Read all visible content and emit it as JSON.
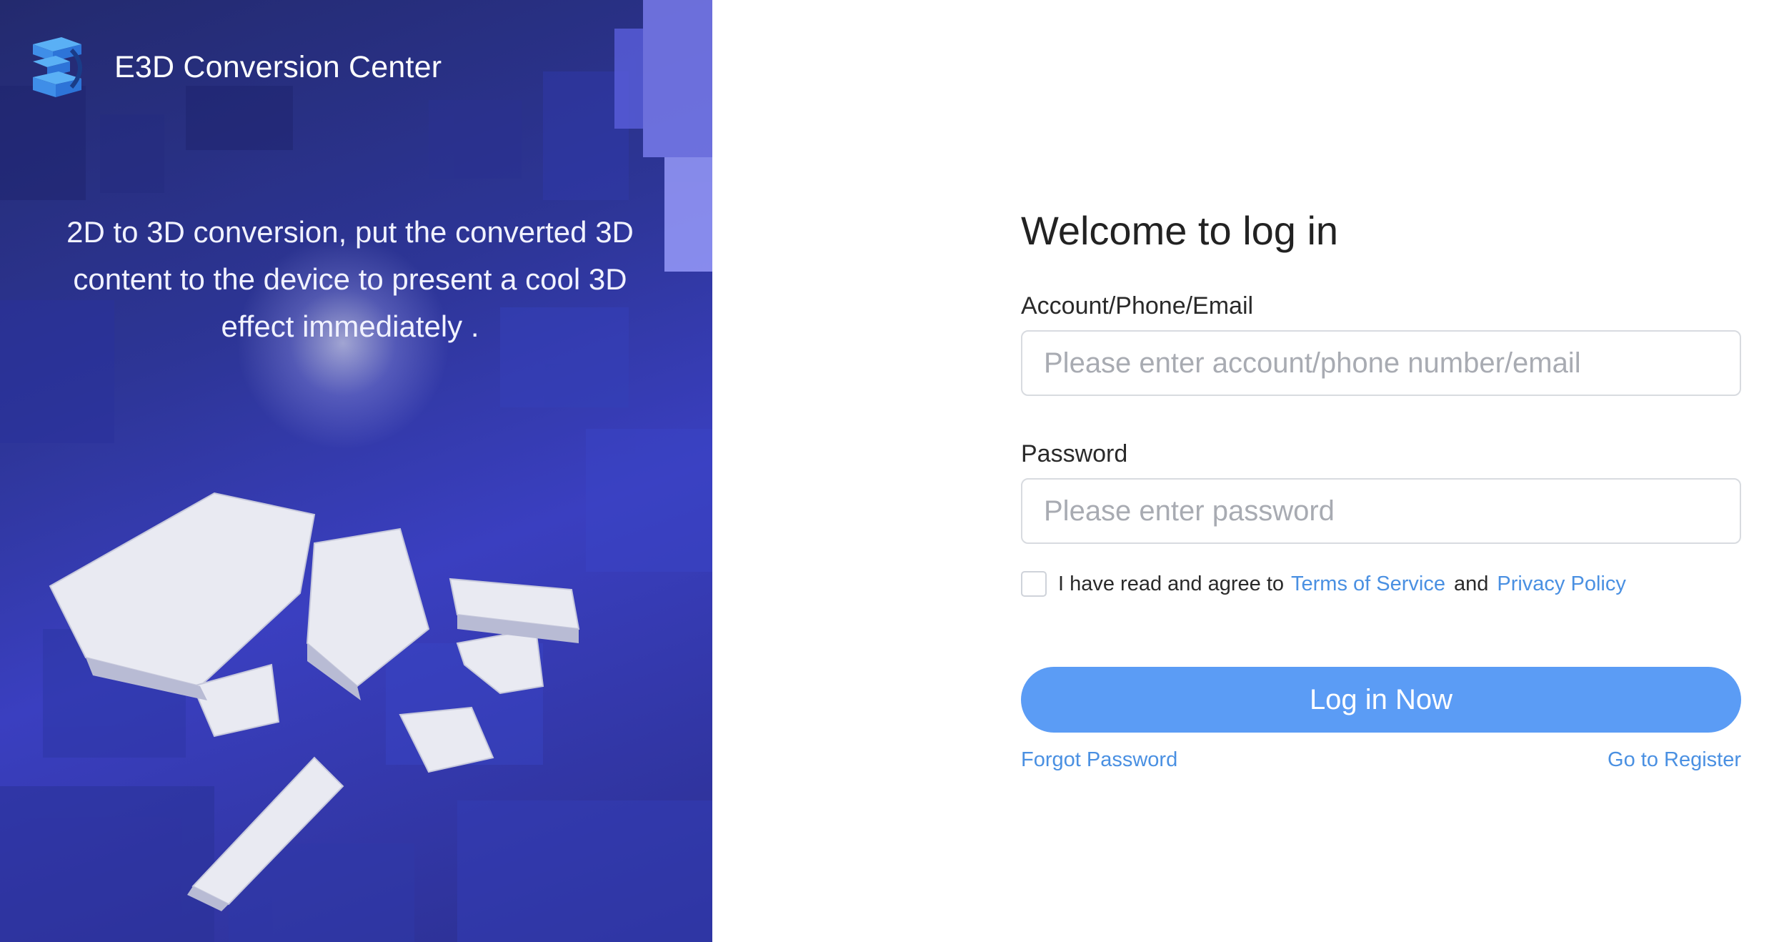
{
  "brand": {
    "name": "E3D Conversion Center",
    "logo_icon": "e3d-logo-icon"
  },
  "hero": {
    "tagline": "2D to 3D conversion, put the converted 3D content to the device to present a cool 3D effect immediately ."
  },
  "login": {
    "title": "Welcome to log in",
    "account_label": "Account/Phone/Email",
    "account_placeholder": "Please enter account/phone number/email",
    "account_value": "",
    "password_label": "Password",
    "password_placeholder": "Please enter password",
    "password_value": "",
    "agree_prefix": "I have read and agree to",
    "terms_link": "Terms of Service",
    "agree_conj": "and",
    "privacy_link": "Privacy Policy",
    "agree_checked": false,
    "submit_label": "Log in Now",
    "forgot_link": "Forgot Password",
    "register_link": "Go to Register"
  },
  "colors": {
    "accent": "#5b9cf5",
    "link": "#4a90e2",
    "hero_bg": "#2d3596"
  }
}
